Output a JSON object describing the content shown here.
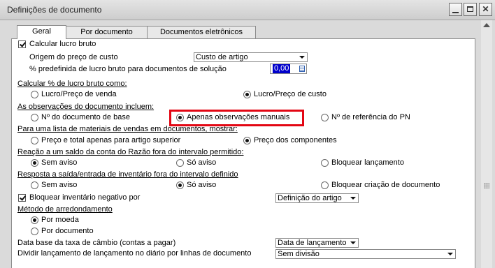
{
  "window": {
    "title": "Definições de documento"
  },
  "tabs": [
    "Geral",
    "Por documento",
    "Documentos eletrônicos"
  ],
  "gross_profit": {
    "calc_label": "Calcular lucro bruto",
    "cost_origin_label": "Origem do preço de custo",
    "cost_origin_value": "Custo de artigo",
    "default_pct_label": "% predefinida de lucro bruto para documentos de solução",
    "default_pct_value": "0,00"
  },
  "calc_pct": {
    "heading": "Calcular % de lucro bruto como:",
    "opt1": "Lucro/Preço de venda",
    "opt2": "Lucro/Preço de custo"
  },
  "remarks": {
    "heading": "As observações do documento incluem:",
    "opt1": "Nº do documento de base",
    "opt2": "Apenas observações manuais",
    "opt3": "Nº de referência do PN"
  },
  "sales_bom": {
    "heading": "Para uma lista de materiais de vendas em documentos, mostrar:",
    "opt1": "Preço e total apenas para artigo superior",
    "opt2": "Preço dos componentes"
  },
  "gl_balance": {
    "heading": "Reação a um saldo da conta do Razão fora do intervalo permitido:",
    "opt1": "Sem aviso",
    "opt2": "Só aviso",
    "opt3": "Bloquear lançamento"
  },
  "inventory": {
    "heading": "Resposta a saída/entrada de inventário fora do intervalo definido",
    "opt1": "Sem aviso",
    "opt2": "Só aviso",
    "opt3": "Bloquear criação de documento"
  },
  "negative_inventory": {
    "label": "Bloquear inventário negativo por",
    "value": "Definição do artigo"
  },
  "rounding": {
    "heading": "Método de arredondamento",
    "opt1": "Por moeda",
    "opt2": "Por documento"
  },
  "exchange_rate": {
    "label": "Data base da taxa de câmbio (contas a pagar)",
    "value": "Data de lançamento"
  },
  "split_posting": {
    "label": "Dividir lançamento de lançamento no diário por linhas de documento",
    "value": "Sem divisão"
  },
  "colors": {
    "highlight": "#e30613",
    "selection": "#0000cc"
  }
}
